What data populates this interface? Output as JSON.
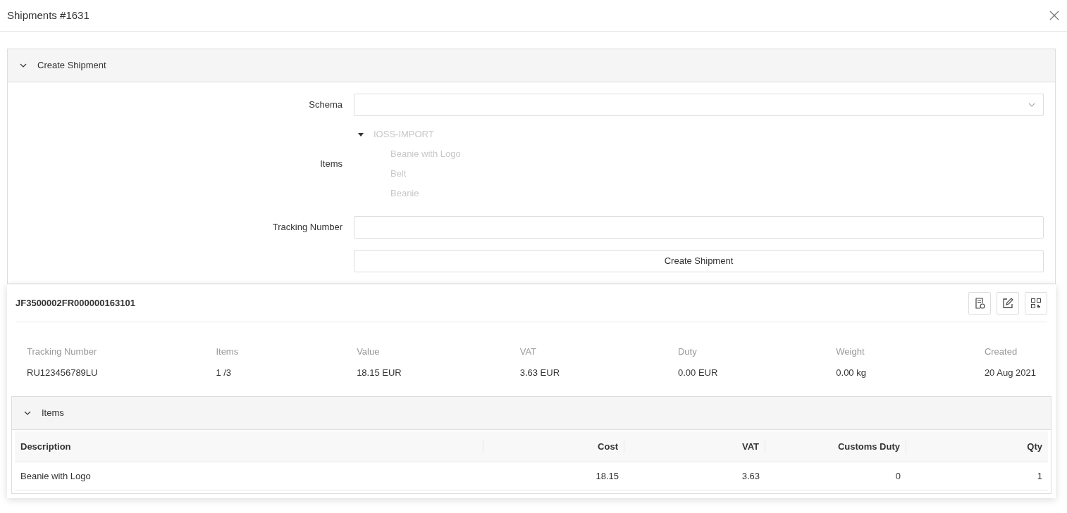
{
  "dialog": {
    "title": "Shipments #1631"
  },
  "create_panel": {
    "title": "Create Shipment",
    "expanded": true,
    "schema": {
      "label": "Schema"
    },
    "items": {
      "label": "Items",
      "disabled": true,
      "tree": [
        {
          "label": "IOSS-IMPORT",
          "expanded": true,
          "children": [
            {
              "label": "Beanie with Logo"
            },
            {
              "label": "Belt"
            },
            {
              "label": "Beanie"
            }
          ]
        }
      ]
    },
    "tracking": {
      "label": "Tracking Number"
    },
    "button": "Create Shipment"
  },
  "shipment": {
    "code": "JF3500002FR000000163101",
    "details": [
      {
        "label": "Tracking Number",
        "value": "RU123456789LU"
      },
      {
        "label": "Items",
        "value": "1 /3"
      },
      {
        "label": "Value",
        "value": "18.15 EUR"
      },
      {
        "label": "VAT",
        "value": "3.63 EUR"
      },
      {
        "label": "Duty",
        "value": "0.00 EUR"
      },
      {
        "label": "Weight",
        "value": "0.00 kg"
      },
      {
        "label": "Created",
        "value": "20 Aug 2021"
      }
    ],
    "items_panel": {
      "title": "Items",
      "expanded": true,
      "table": {
        "columns": [
          "Description",
          "Cost",
          "VAT",
          "Customs Duty",
          "Qty"
        ],
        "rows": [
          [
            "Beanie with Logo",
            "18.15",
            "3.63",
            "0",
            "1"
          ]
        ]
      }
    }
  }
}
